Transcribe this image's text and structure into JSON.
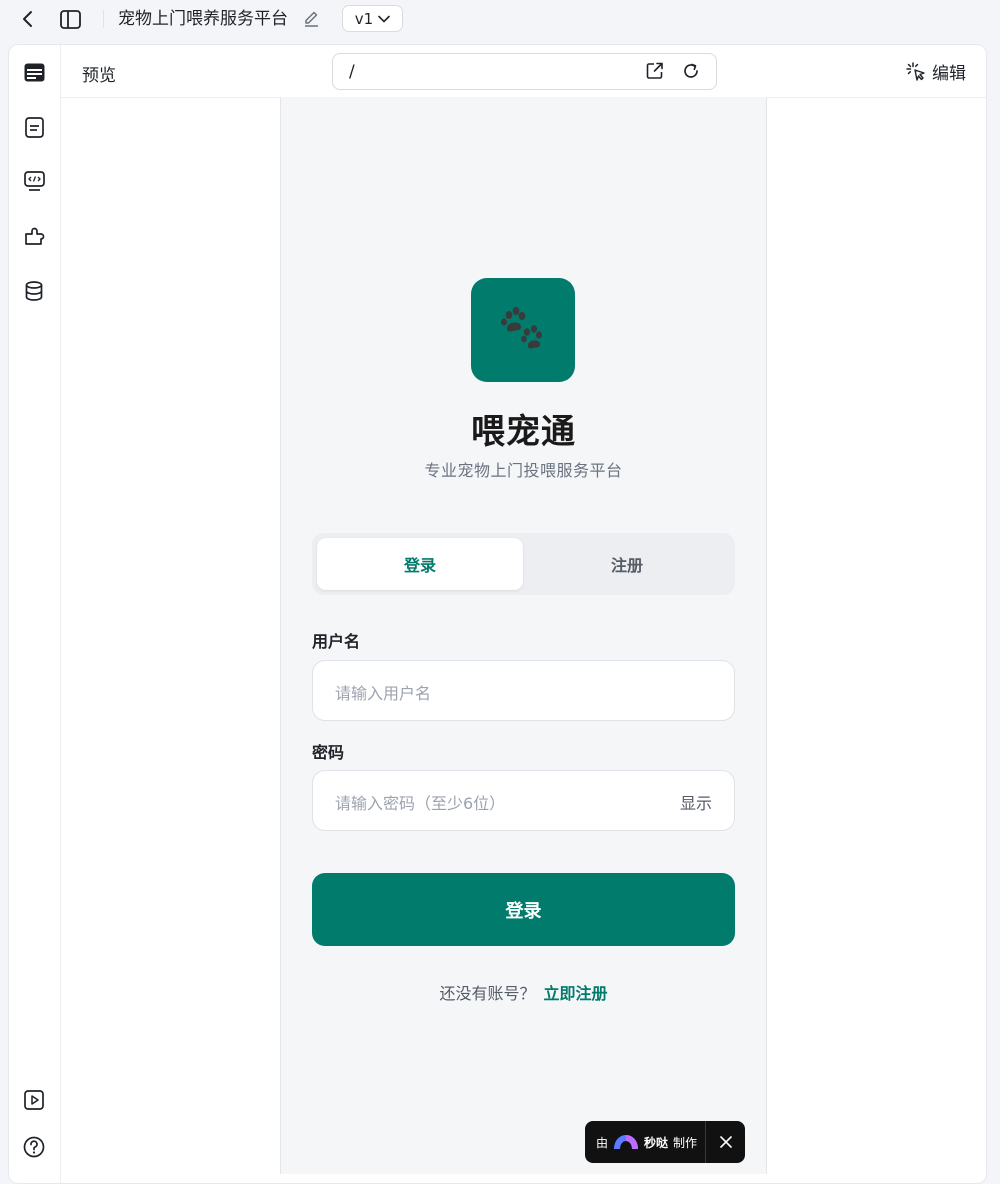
{
  "topbar": {
    "title": "宠物上门喂养服务平台",
    "version": "v1"
  },
  "preview_header": {
    "label": "预览",
    "url": "/",
    "edit_label": "编辑"
  },
  "app": {
    "name": "喂宠通",
    "subtitle": "专业宠物上门投喂服务平台",
    "logo_icon": "paw-icon",
    "brand_color": "#007b6c",
    "tabs": [
      {
        "label": "登录",
        "active": true
      },
      {
        "label": "注册",
        "active": false
      }
    ],
    "username": {
      "label": "用户名",
      "placeholder": "请输入用户名"
    },
    "password": {
      "label": "密码",
      "placeholder": "请输入密码（至少6位）",
      "toggle": "显示"
    },
    "submit_label": "登录",
    "footer_prompt": "还没有账号？",
    "footer_link": "立即注册"
  },
  "badge": {
    "prefix": "由",
    "brand": "秒哒",
    "suffix": "制作"
  }
}
